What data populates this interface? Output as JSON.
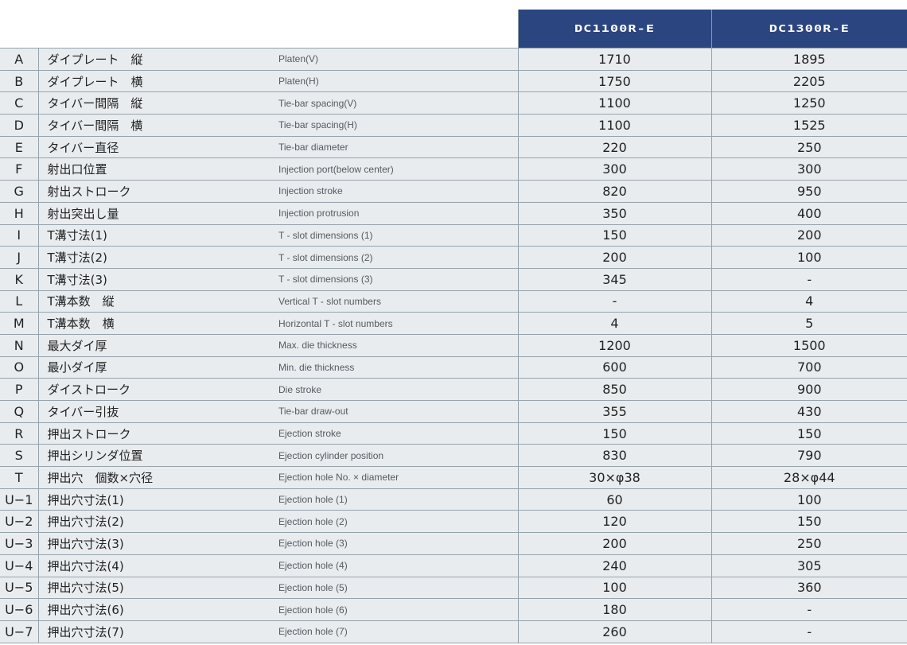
{
  "header": {
    "models": [
      "DC1100R-E",
      "DC1300R-E"
    ]
  },
  "rows": [
    {
      "code": "A",
      "ja": "ダイプレート　縦",
      "en": "Platen(V)",
      "values": [
        "1710",
        "1895"
      ]
    },
    {
      "code": "B",
      "ja": "ダイプレート　横",
      "en": "Platen(H)",
      "values": [
        "1750",
        "2205"
      ]
    },
    {
      "code": "C",
      "ja": "タイバー間隔　縦",
      "en": "Tie-bar spacing(V)",
      "values": [
        "1100",
        "1250"
      ]
    },
    {
      "code": "D",
      "ja": "タイバー間隔　横",
      "en": "Tie-bar spacing(H)",
      "values": [
        "1100",
        "1525"
      ]
    },
    {
      "code": "E",
      "ja": "タイバー直径",
      "en": "Tie-bar diameter",
      "values": [
        "220",
        "250"
      ]
    },
    {
      "code": "F",
      "ja": "射出口位置",
      "en": "Injection port(below center)",
      "values": [
        "300",
        "300"
      ]
    },
    {
      "code": "G",
      "ja": "射出ストローク",
      "en": "Injection stroke",
      "values": [
        "820",
        "950"
      ]
    },
    {
      "code": "H",
      "ja": "射出突出し量",
      "en": "Injection protrusion",
      "values": [
        "350",
        "400"
      ]
    },
    {
      "code": "I",
      "ja": "T溝寸法(1)",
      "en": "T - slot dimensions (1)",
      "values": [
        "150",
        "200"
      ]
    },
    {
      "code": "J",
      "ja": "T溝寸法(2)",
      "en": "T - slot dimensions (2)",
      "values": [
        "200",
        "100"
      ]
    },
    {
      "code": "K",
      "ja": "T溝寸法(3)",
      "en": "T - slot dimensions (3)",
      "values": [
        "345",
        "-"
      ]
    },
    {
      "code": "L",
      "ja": "T溝本数　縦",
      "en": "Vertical T - slot numbers",
      "values": [
        "-",
        "4"
      ]
    },
    {
      "code": "M",
      "ja": "T溝本数　横",
      "en": "Horizontal T - slot numbers",
      "values": [
        "4",
        "5"
      ]
    },
    {
      "code": "N",
      "ja": "最大ダイ厚",
      "en": "Max. die thickness",
      "values": [
        "1200",
        "1500"
      ]
    },
    {
      "code": "O",
      "ja": "最小ダイ厚",
      "en": "Min. die thickness",
      "values": [
        "600",
        "700"
      ]
    },
    {
      "code": "P",
      "ja": "ダイストローク",
      "en": "Die stroke",
      "values": [
        "850",
        "900"
      ]
    },
    {
      "code": "Q",
      "ja": "タイバー引抜",
      "en": "Tie-bar draw-out",
      "values": [
        "355",
        "430"
      ]
    },
    {
      "code": "R",
      "ja": "押出ストローク",
      "en": "Ejection stroke",
      "values": [
        "150",
        "150"
      ]
    },
    {
      "code": "S",
      "ja": "押出シリンダ位置",
      "en": "Ejection cylinder position",
      "values": [
        "830",
        "790"
      ]
    },
    {
      "code": "T",
      "ja": "押出穴　個数×穴径",
      "en": "Ejection hole No. × diameter",
      "values": [
        "30×φ38",
        "28×φ44"
      ]
    },
    {
      "code": "U−1",
      "ja": "押出穴寸法(1)",
      "en": "Ejection hole (1)",
      "values": [
        "60",
        "100"
      ]
    },
    {
      "code": "U−2",
      "ja": "押出穴寸法(2)",
      "en": "Ejection hole (2)",
      "values": [
        "120",
        "150"
      ]
    },
    {
      "code": "U−3",
      "ja": "押出穴寸法(3)",
      "en": "Ejection hole (3)",
      "values": [
        "200",
        "250"
      ]
    },
    {
      "code": "U−4",
      "ja": "押出穴寸法(4)",
      "en": "Ejection hole (4)",
      "values": [
        "240",
        "305"
      ]
    },
    {
      "code": "U−5",
      "ja": "押出穴寸法(5)",
      "en": "Ejection hole (5)",
      "values": [
        "100",
        "360"
      ]
    },
    {
      "code": "U−6",
      "ja": "押出穴寸法(6)",
      "en": "Ejection hole (6)",
      "values": [
        "180",
        "-"
      ]
    },
    {
      "code": "U−7",
      "ja": "押出穴寸法(7)",
      "en": "Ejection hole (7)",
      "values": [
        "260",
        "-"
      ]
    }
  ],
  "colors": {
    "header_bg": "#2b4580",
    "header_text": "#ffffff",
    "row_bg": "#e9ecef",
    "border": "#95a3ad"
  }
}
